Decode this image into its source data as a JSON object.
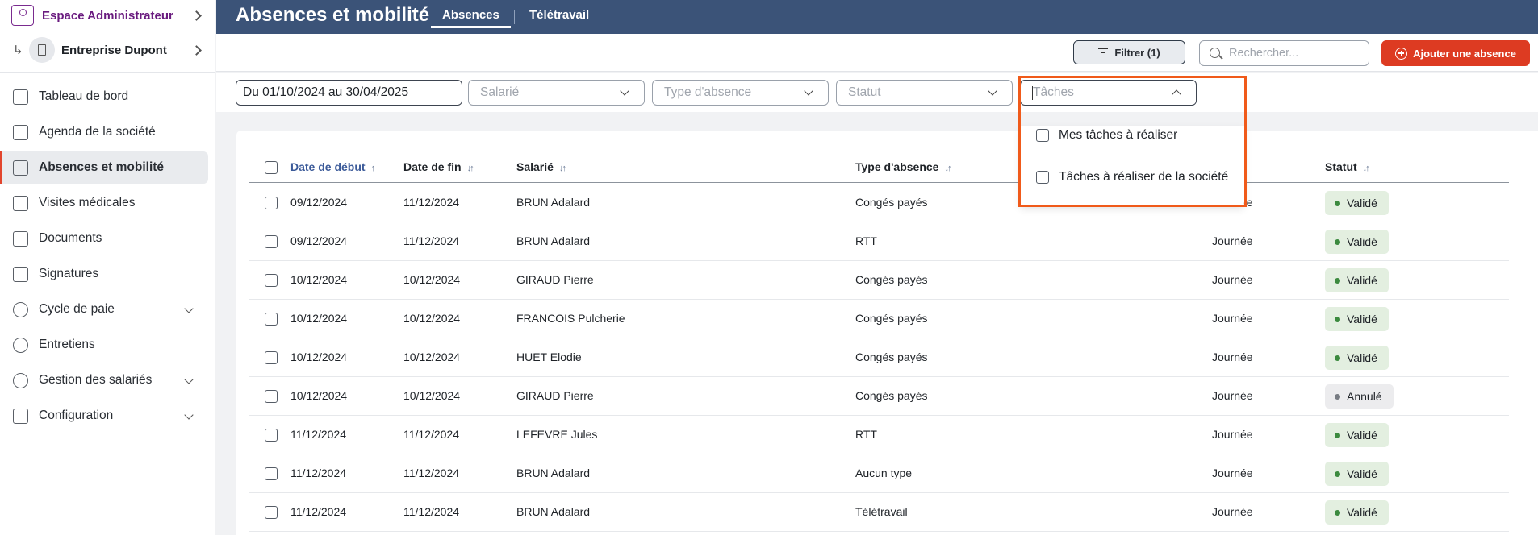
{
  "sidebar": {
    "admin_label": "Espace Administrateur",
    "company_label": "Entreprise Dupont",
    "items": [
      {
        "label": "Tableau de bord",
        "icon": "dashboard-icon"
      },
      {
        "label": "Agenda de la société",
        "icon": "calendar-icon"
      },
      {
        "label": "Absences et mobilité",
        "icon": "list-icon",
        "active": true
      },
      {
        "label": "Visites médicales",
        "icon": "medical-cross-icon"
      },
      {
        "label": "Documents",
        "icon": "folder-icon"
      },
      {
        "label": "Signatures",
        "icon": "pen-icon"
      },
      {
        "label": "Cycle de paie",
        "icon": "payroll-icon",
        "expandable": true
      },
      {
        "label": "Entretiens",
        "icon": "chat-icon"
      },
      {
        "label": "Gestion des salariés",
        "icon": "users-icon",
        "expandable": true
      },
      {
        "label": "Configuration",
        "icon": "config-icon",
        "expandable": true
      }
    ]
  },
  "header": {
    "title": "Absences et mobilité",
    "tabs": [
      {
        "label": "Absences",
        "active": true
      },
      {
        "label": "Télétravail"
      }
    ]
  },
  "actions": {
    "filter_label": "Filtrer (1)",
    "search_placeholder": "Rechercher...",
    "add_label": "Ajouter une absence"
  },
  "filters": {
    "date_range": "Du 01/10/2024 au 30/04/2025",
    "employee_placeholder": "Salarié",
    "type_placeholder": "Type d'absence",
    "status_placeholder": "Statut",
    "tasks_placeholder": "Tâches"
  },
  "tasks_dropdown": {
    "options": [
      "Mes tâches à réaliser",
      "Tâches à réaliser de la société"
    ]
  },
  "table": {
    "columns": {
      "start": "Date de début",
      "end": "Date de fin",
      "employee": "Salarié",
      "type": "Type d'absence",
      "status": "Statut"
    },
    "rows": [
      {
        "start": "09/12/2024",
        "end": "11/12/2024",
        "employee": "BRUN Adalard",
        "type": "Congés payés",
        "duration": "Journée",
        "status": "Validé"
      },
      {
        "start": "09/12/2024",
        "end": "11/12/2024",
        "employee": "BRUN Adalard",
        "type": "RTT",
        "duration": "Journée",
        "status": "Validé"
      },
      {
        "start": "10/12/2024",
        "end": "10/12/2024",
        "employee": "GIRAUD Pierre",
        "type": "Congés payés",
        "duration": "Journée",
        "status": "Validé"
      },
      {
        "start": "10/12/2024",
        "end": "10/12/2024",
        "employee": "FRANCOIS Pulcherie",
        "type": "Congés payés",
        "duration": "Journée",
        "status": "Validé"
      },
      {
        "start": "10/12/2024",
        "end": "10/12/2024",
        "employee": "HUET Elodie",
        "type": "Congés payés",
        "duration": "Journée",
        "status": "Validé"
      },
      {
        "start": "10/12/2024",
        "end": "10/12/2024",
        "employee": "GIRAUD Pierre",
        "type": "Congés payés",
        "duration": "Journée",
        "status": "Annulé"
      },
      {
        "start": "11/12/2024",
        "end": "11/12/2024",
        "employee": "LEFEVRE Jules",
        "type": "RTT",
        "duration": "Journée",
        "status": "Validé"
      },
      {
        "start": "11/12/2024",
        "end": "11/12/2024",
        "employee": "BRUN Adalard",
        "type": "Aucun type",
        "duration": "Journée",
        "status": "Validé"
      },
      {
        "start": "11/12/2024",
        "end": "11/12/2024",
        "employee": "BRUN Adalard",
        "type": "Télétravail",
        "duration": "Journée",
        "status": "Validé"
      }
    ]
  },
  "colors": {
    "topbar": "#3b5378",
    "accent": "#dd3b22",
    "admin": "#6a1b7f",
    "highlight": "#f05a1a",
    "valid": "#3c8a3f"
  }
}
